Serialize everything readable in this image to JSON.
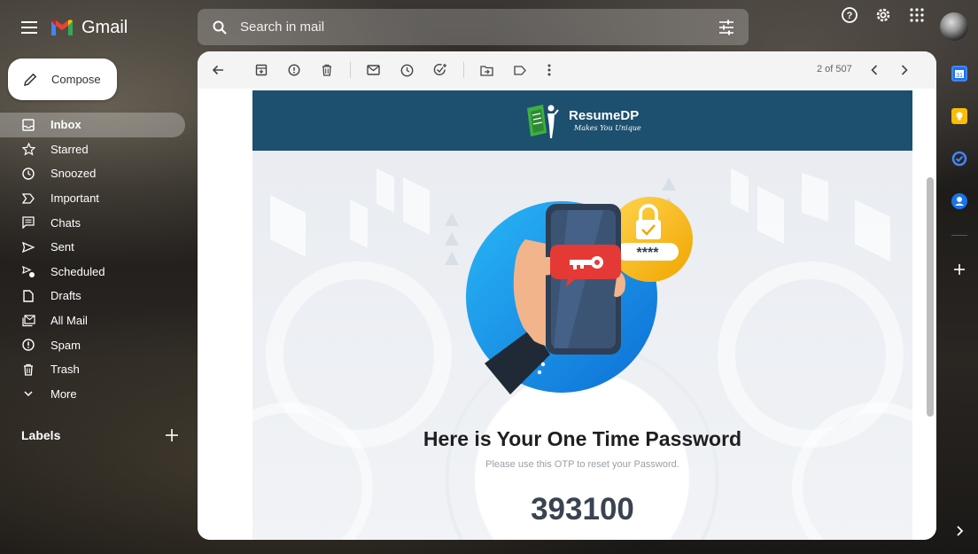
{
  "app": {
    "name": "Gmail"
  },
  "search": {
    "placeholder": "Search in mail"
  },
  "compose": {
    "label": "Compose"
  },
  "nav": {
    "items": [
      {
        "label": "Inbox",
        "icon": "inbox-icon",
        "active": true
      },
      {
        "label": "Starred",
        "icon": "star-icon"
      },
      {
        "label": "Snoozed",
        "icon": "clock-icon"
      },
      {
        "label": "Important",
        "icon": "important-icon"
      },
      {
        "label": "Chats",
        "icon": "chat-icon"
      },
      {
        "label": "Sent",
        "icon": "send-icon"
      },
      {
        "label": "Scheduled",
        "icon": "scheduled-send-icon"
      },
      {
        "label": "Drafts",
        "icon": "draft-icon"
      },
      {
        "label": "All Mail",
        "icon": "all-mail-icon"
      },
      {
        "label": "Spam",
        "icon": "spam-icon"
      },
      {
        "label": "Trash",
        "icon": "trash-icon"
      },
      {
        "label": "More",
        "icon": "chevron-down-icon"
      }
    ]
  },
  "labels": {
    "title": "Labels"
  },
  "toolbar": {
    "counter": "2 of 507"
  },
  "email": {
    "brand_name": "ResumeDP",
    "brand_tagline": "Makes You Unique",
    "lock_mask": "****",
    "title": "Here is Your One Time Password",
    "subtitle": "Please use this OTP to reset your Password.",
    "otp": "393100"
  },
  "colors": {
    "brand_bar": "#1d4f6e",
    "accent_blue": "#1a73e8",
    "otp_text": "#3a4351"
  }
}
